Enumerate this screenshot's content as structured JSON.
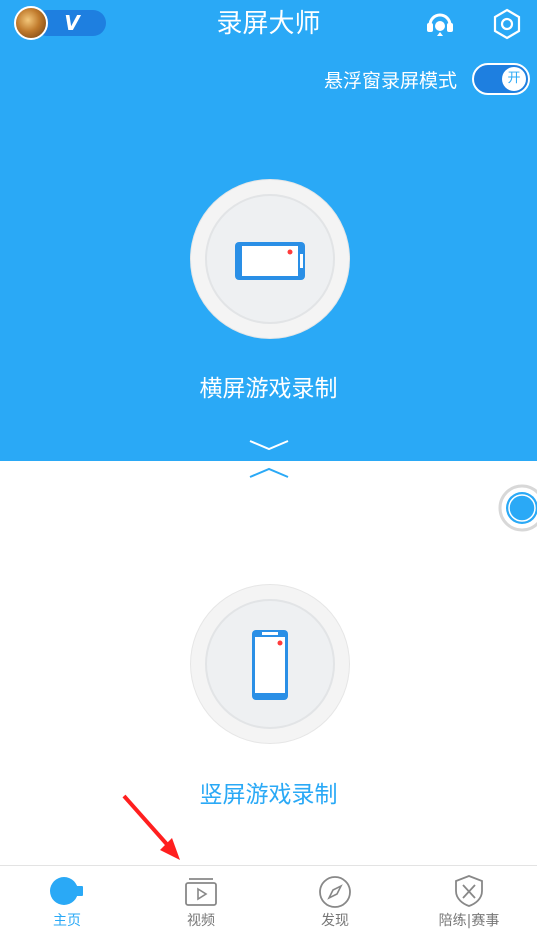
{
  "header": {
    "title": "录屏大师",
    "vip_badge": "V",
    "icons": {
      "support": "headset-support-icon",
      "settings": "gear-icon"
    }
  },
  "float_mode": {
    "label": "悬浮窗录屏模式",
    "toggle_state": "开"
  },
  "record_options": {
    "landscape_label": "横屏游戏录制",
    "portrait_label": "竖屏游戏录制"
  },
  "colors": {
    "primary_blue": "#2aa9f6",
    "accent_red": "#ff3b3b",
    "tab_inactive": "#777777"
  },
  "tabs": [
    {
      "label": "主页",
      "icon": "camera-icon",
      "active": true
    },
    {
      "label": "视频",
      "icon": "video-play-icon",
      "active": false
    },
    {
      "label": "发现",
      "icon": "compass-icon",
      "active": false
    },
    {
      "label": "陪练|赛事",
      "icon": "shield-swords-icon",
      "active": false
    }
  ]
}
